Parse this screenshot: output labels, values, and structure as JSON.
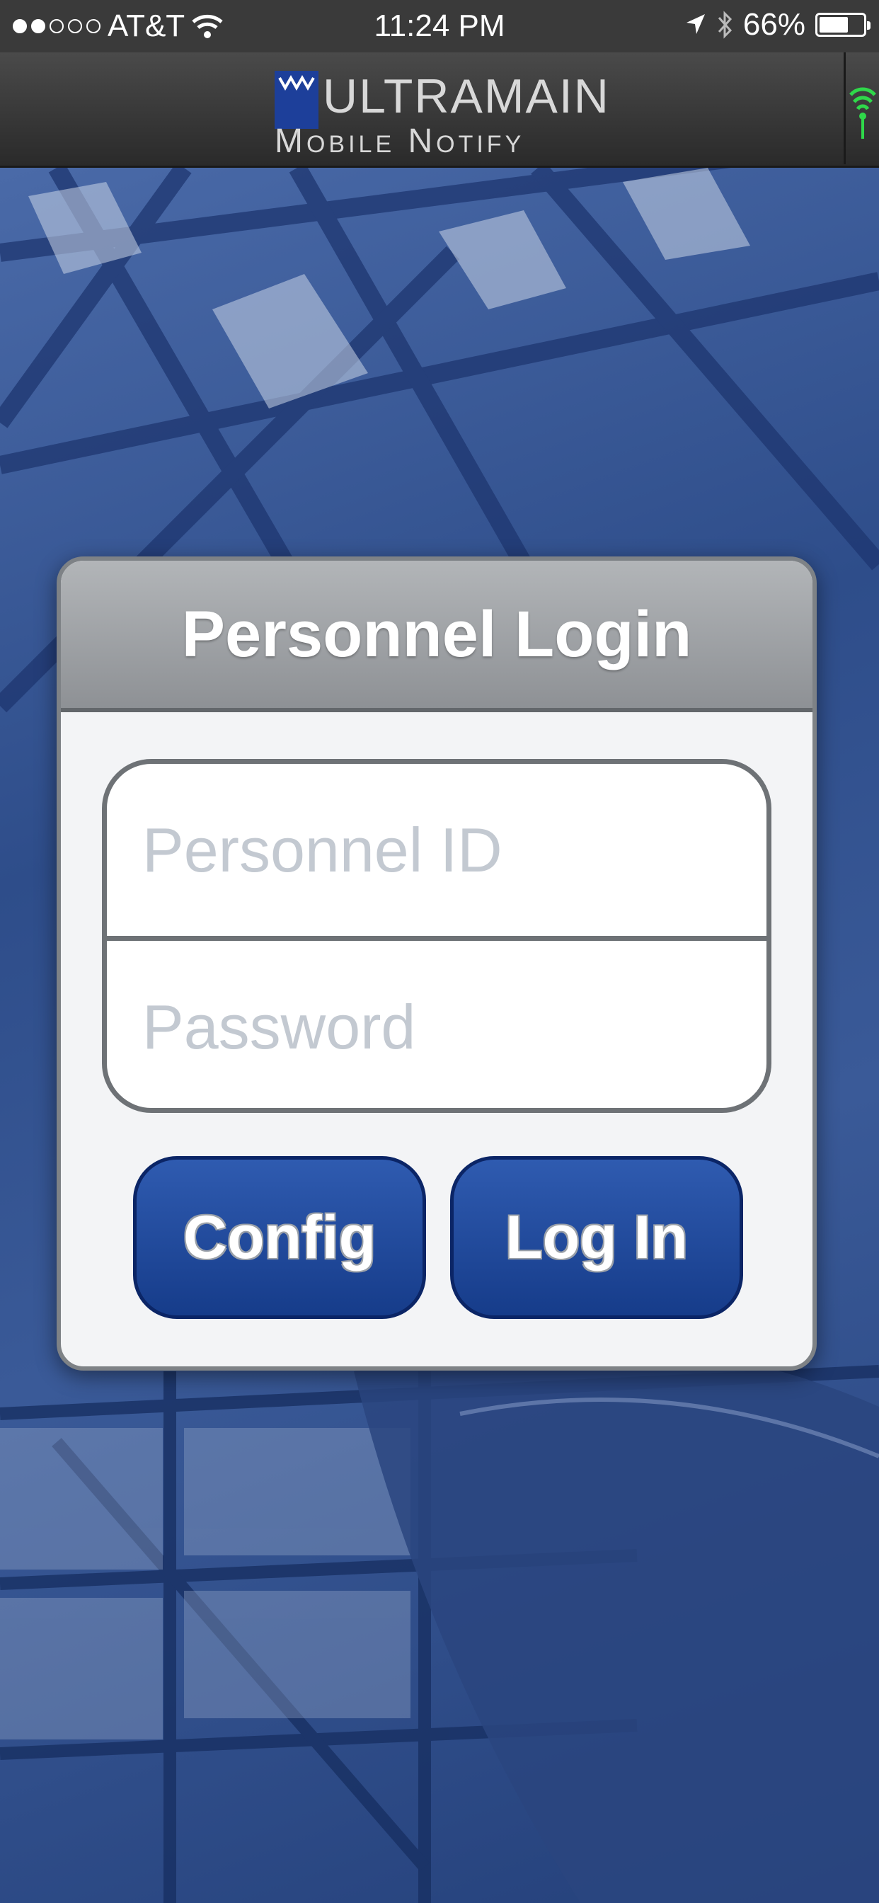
{
  "status_bar": {
    "carrier": "AT&T",
    "time": "11:24 PM",
    "battery_percent": "66%",
    "battery_level": 0.66,
    "signal_dots_filled": 2,
    "signal_dots_total": 5
  },
  "nav_bar": {
    "logo_line1": "ULTRAMAIN",
    "logo_line2": "Mobile Notify",
    "connection_icon": "wireless-signal-icon",
    "connection_color": "#2fd84a"
  },
  "login": {
    "title": "Personnel Login",
    "personnel_id_placeholder": "Personnel ID",
    "personnel_id_value": "",
    "password_placeholder": "Password",
    "password_value": "",
    "config_label": "Config",
    "login_label": "Log In"
  },
  "colors": {
    "button_blue": "#1d47a0",
    "background_blue": "#2e4d8a"
  }
}
